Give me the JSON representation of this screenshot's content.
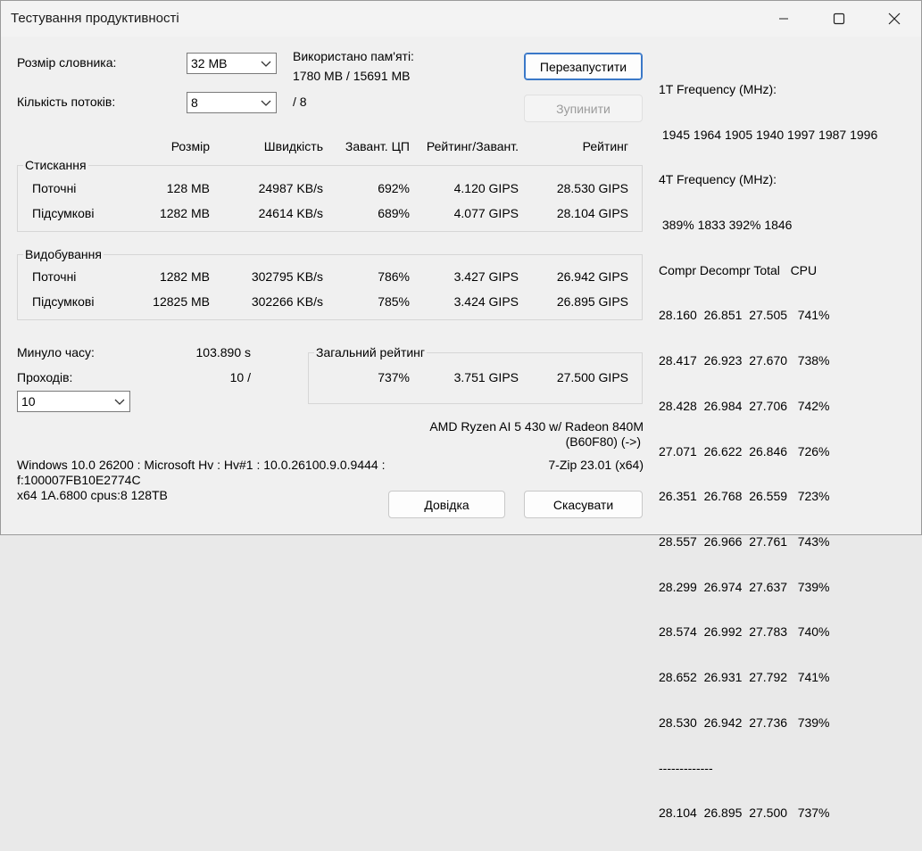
{
  "window": {
    "title": "Тестування продуктивності"
  },
  "dictionary": {
    "label": "Розмір словника:",
    "value": "32 MB"
  },
  "threads": {
    "label": "Кількість потоків:",
    "value": "8",
    "max": "/ 8"
  },
  "memory": {
    "label": "Використано пам'яті:",
    "value": "1780 MB / 15691 MB"
  },
  "buttons": {
    "restart": "Перезапустити",
    "stop": "Зупинити",
    "help": "Довідка",
    "cancel": "Скасувати"
  },
  "headers": {
    "size": "Розмір",
    "speed": "Швидкість",
    "cpu": "Завант. ЦП",
    "rating_load": "Рейтинг/Завант.",
    "rating": "Рейтинг"
  },
  "compress": {
    "title": "Стискання",
    "rows": [
      {
        "label": "Поточні",
        "size": "128 MB",
        "speed": "24987 KB/s",
        "cpu": "692%",
        "rating_load": "4.120 GIPS",
        "rating": "28.530 GIPS"
      },
      {
        "label": "Підсумкові",
        "size": "1282 MB",
        "speed": "24614 KB/s",
        "cpu": "689%",
        "rating_load": "4.077 GIPS",
        "rating": "28.104 GIPS"
      }
    ]
  },
  "decompress": {
    "title": "Видобування",
    "rows": [
      {
        "label": "Поточні",
        "size": "1282 MB",
        "speed": "302795 KB/s",
        "cpu": "786%",
        "rating_load": "3.427 GIPS",
        "rating": "26.942 GIPS"
      },
      {
        "label": "Підсумкові",
        "size": "12825 MB",
        "speed": "302266 KB/s",
        "cpu": "785%",
        "rating_load": "3.424 GIPS",
        "rating": "26.895 GIPS"
      }
    ]
  },
  "elapsed": {
    "label": "Минуло часу:",
    "value": "103.890 s"
  },
  "passes": {
    "label": "Проходів:",
    "value": "10 /",
    "select": "10"
  },
  "total": {
    "title": "Загальний рейтинг",
    "cpu": "737%",
    "rating_load": "3.751 GIPS",
    "rating": "27.500 GIPS"
  },
  "cpu_info": {
    "line1": "AMD Ryzen AI 5 430 w/ Radeon 840M",
    "line2": "(B60F80) (->)"
  },
  "version": "7-Zip 23.01 (x64)",
  "sys_info": {
    "line1": "Windows 10.0 26200 : Microsoft Hv : Hv#1 : 10.0.26100.9.0.9444 :",
    "line2": "f:100007FB10E2774C",
    "line3": "x64 1A.6800 cpus:8 128TB"
  },
  "log": {
    "freq1_title": "1T Frequency (MHz):",
    "freq1_values": " 1945 1964 1905 1940 1997 1987 1996",
    "freq4_title": "4T Frequency (MHz):",
    "freq4_values": " 389% 1833 392% 1846",
    "table_header": "Compr Decompr Total   CPU",
    "rows": [
      "28.160  26.851  27.505   741%",
      "28.417  26.923  27.670   738%",
      "28.428  26.984  27.706   742%",
      "27.071  26.622  26.846   726%",
      "26.351  26.768  26.559   723%",
      "28.557  26.966  27.761   743%",
      "28.299  26.974  27.637   739%",
      "28.574  26.992  27.783   740%",
      "28.652  26.931  27.792   741%",
      "28.530  26.942  27.736   739%"
    ],
    "separator": "-------------",
    "summary": "28.104  26.895  27.500   737%"
  }
}
